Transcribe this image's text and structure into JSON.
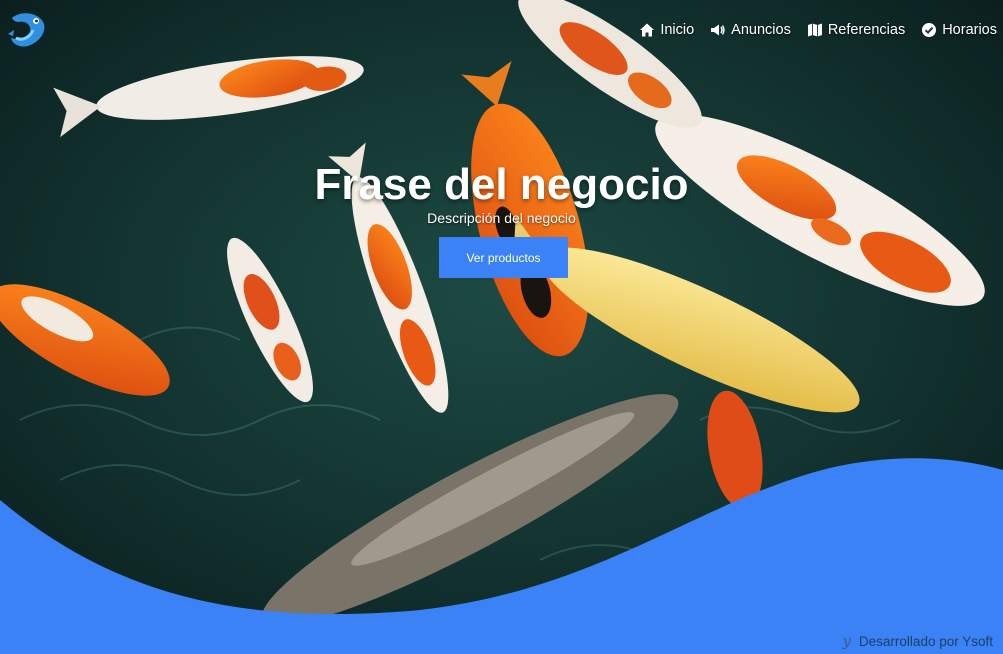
{
  "brand": {
    "logo_icon": "fish-logo-icon"
  },
  "nav": {
    "items": [
      {
        "label": "Inicio",
        "icon": "home-icon"
      },
      {
        "label": "Anuncios",
        "icon": "megaphone-icon"
      },
      {
        "label": "Referencias",
        "icon": "map-icon"
      },
      {
        "label": "Horarios",
        "icon": "check-circle-icon"
      }
    ]
  },
  "hero": {
    "title": "Frase del negocio",
    "subtitle": "Descripción del negocio",
    "button_label": "Ver productos"
  },
  "footer": {
    "credit_mark": "y",
    "credit_text": "Desarrollado por Ysoft"
  },
  "colors": {
    "accent": "#3b82f6",
    "wave": "#3b82f6"
  }
}
